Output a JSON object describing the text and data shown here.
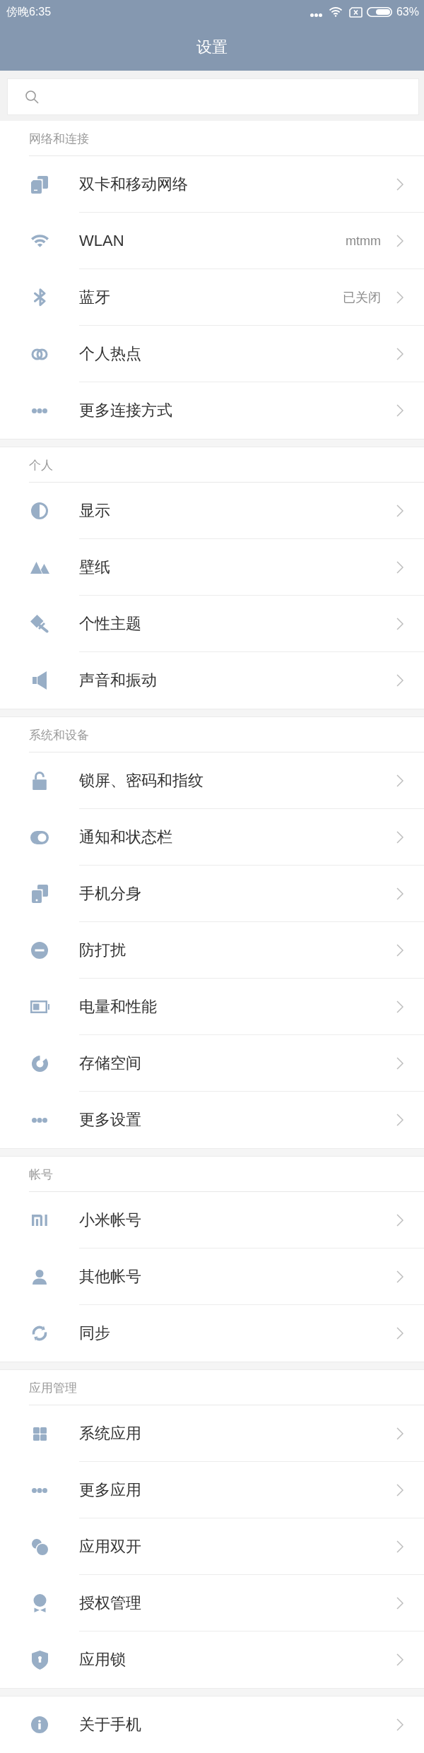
{
  "status_bar": {
    "time": "傍晚6:35",
    "battery": "63%"
  },
  "title": "设置",
  "sections": [
    {
      "title": "网络和连接",
      "items": [
        {
          "label": "双卡和移动网络"
        },
        {
          "label": "WLAN",
          "value": "mtmm"
        },
        {
          "label": "蓝牙",
          "value": "已关闭"
        },
        {
          "label": "个人热点"
        },
        {
          "label": "更多连接方式"
        }
      ]
    },
    {
      "title": "个人",
      "items": [
        {
          "label": "显示"
        },
        {
          "label": "壁纸"
        },
        {
          "label": "个性主题"
        },
        {
          "label": "声音和振动"
        }
      ]
    },
    {
      "title": "系统和设备",
      "items": [
        {
          "label": "锁屏、密码和指纹"
        },
        {
          "label": "通知和状态栏"
        },
        {
          "label": "手机分身"
        },
        {
          "label": "防打扰"
        },
        {
          "label": "电量和性能"
        },
        {
          "label": "存储空间"
        },
        {
          "label": "更多设置"
        }
      ]
    },
    {
      "title": "帐号",
      "items": [
        {
          "label": "小米帐号"
        },
        {
          "label": "其他帐号"
        },
        {
          "label": "同步"
        }
      ]
    },
    {
      "title": "应用管理",
      "items": [
        {
          "label": "系统应用"
        },
        {
          "label": "更多应用"
        },
        {
          "label": "应用双开"
        },
        {
          "label": "授权管理"
        },
        {
          "label": "应用锁"
        }
      ]
    },
    {
      "items": [
        {
          "label": "关于手机"
        }
      ]
    }
  ]
}
